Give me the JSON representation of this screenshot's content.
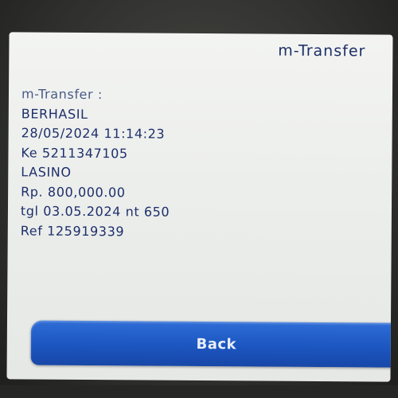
{
  "header": {
    "title": "m-Transfer"
  },
  "receipt": {
    "lines": [
      "m-Transfer :",
      "BERHASIL",
      "28/05/2024 11:14:23",
      "Ke 5211347105",
      "LASINO",
      "Rp. 800,000.00",
      "tgl 03.05.2024 nt 650",
      "Ref 125919339"
    ]
  },
  "actions": {
    "back_label": "Back"
  },
  "colors": {
    "text": "#1e2f6a",
    "button": "#1c56c0",
    "screen_background": "#eceeec"
  }
}
